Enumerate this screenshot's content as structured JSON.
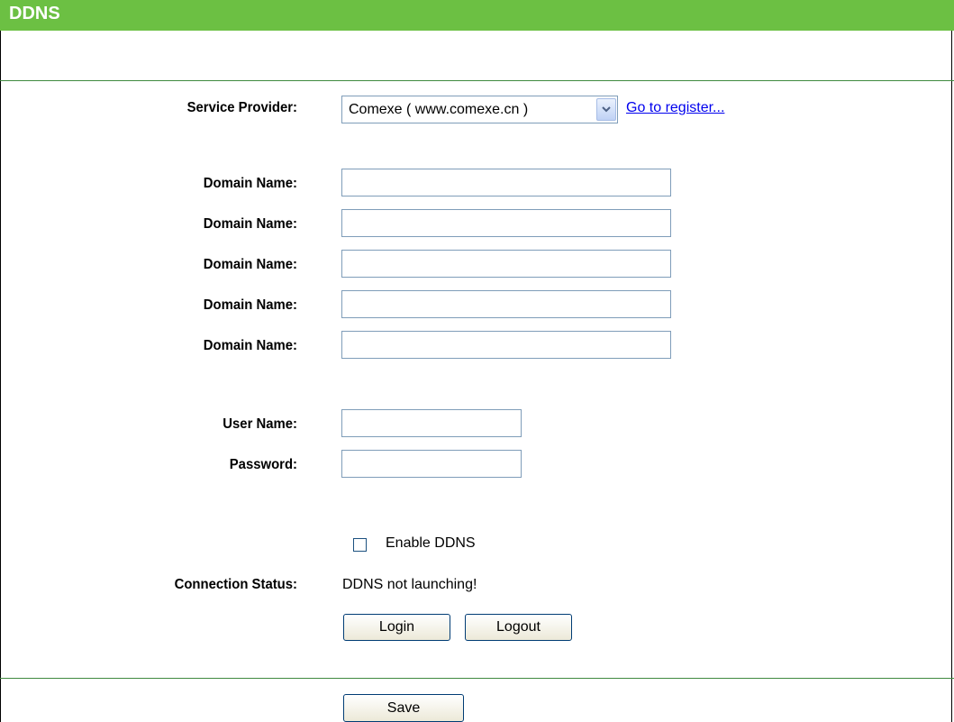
{
  "header": {
    "title": "DDNS"
  },
  "form": {
    "service_provider_label": "Service Provider:",
    "service_provider_value": "Comexe ( www.comexe.cn )",
    "register_link": "Go to register...",
    "domain_name_label": "Domain Name:",
    "domain_names": [
      "",
      "",
      "",
      "",
      ""
    ],
    "user_name_label": "User Name:",
    "user_name_value": "",
    "password_label": "Password:",
    "password_value": "",
    "enable_ddns_label": "Enable DDNS",
    "enable_ddns_checked": false,
    "connection_status_label": "Connection Status:",
    "connection_status_value": "DDNS not launching!",
    "login_label": "Login",
    "logout_label": "Logout"
  },
  "footer": {
    "save_label": "Save"
  }
}
